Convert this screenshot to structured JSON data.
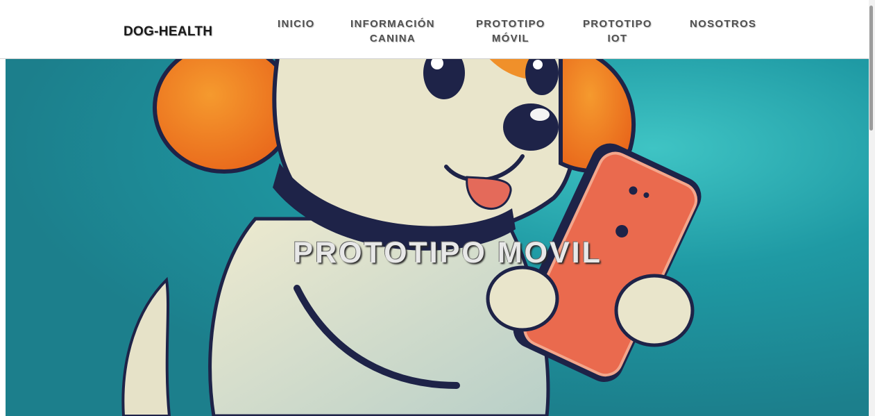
{
  "nav": {
    "brand": "DOG-HEALTH",
    "items": [
      {
        "line1": "INICIO",
        "line2": ""
      },
      {
        "line1": "INFORMACIÓN",
        "line2": "CANINA"
      },
      {
        "line1": "PROTOTIPO",
        "line2": "MÓVIL"
      },
      {
        "line1": "PROTOTIPO",
        "line2": "IOT"
      },
      {
        "line1": "NOSOTROS",
        "line2": ""
      }
    ]
  },
  "hero": {
    "title": "PROTOTIPO MOVIL"
  },
  "colors": {
    "teal_background": "#1f8f9b",
    "dog_body": "#e6e2c8",
    "dog_ears": "#ee7d1f",
    "outline": "#1e2348",
    "phone": "#ea6a4e",
    "tongue": "#e46a5a"
  }
}
